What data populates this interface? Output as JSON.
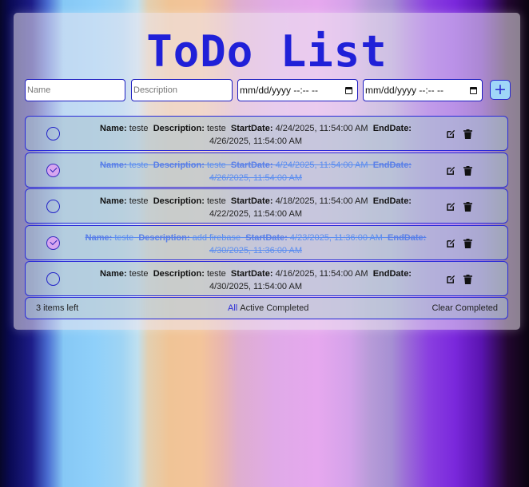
{
  "app": {
    "title": "ToDo List"
  },
  "form": {
    "name_placeholder": "Name",
    "description_placeholder": "Description",
    "start_placeholder": "mm/dd/yyyy --:-- --",
    "end_placeholder": "mm/dd/yyyy --:-- --",
    "add_label": "+"
  },
  "labels": {
    "name": "Name:",
    "description": "Description:",
    "start": "StartDate:",
    "end": "EndDate:"
  },
  "todos": [
    {
      "name": "teste",
      "description": "teste",
      "start": "4/24/2025, 11:54:00 AM",
      "end": "4/26/2025, 11:54:00 AM",
      "completed": false
    },
    {
      "name": "teste",
      "description": "teste",
      "start": "4/24/2025, 11:54:00 AM",
      "end": "4/26/2025, 11:54:00 AM",
      "completed": true
    },
    {
      "name": "teste",
      "description": "teste",
      "start": "4/18/2025, 11:54:00 AM",
      "end": "4/22/2025, 11:54:00 AM",
      "completed": false
    },
    {
      "name": "teste",
      "description": "add firebase",
      "start": "4/23/2025, 11:36:00 AM",
      "end": "4/30/2025, 11:36:00 AM",
      "completed": true
    },
    {
      "name": "teste",
      "description": "teste",
      "start": "4/16/2025, 11:54:00 AM",
      "end": "4/30/2025, 11:54:00 AM",
      "completed": false
    }
  ],
  "footer": {
    "items_left": "3 items left",
    "filter_all": "All",
    "filter_active": "Active",
    "filter_completed": "Completed",
    "clear_completed": "Clear Completed"
  },
  "colors": {
    "accent": "#2020d8",
    "completed_text": "#5b8df0"
  },
  "icons": {
    "edit": "edit-icon",
    "delete": "trash-icon",
    "calendar": "calendar-icon",
    "check": "check-icon"
  }
}
